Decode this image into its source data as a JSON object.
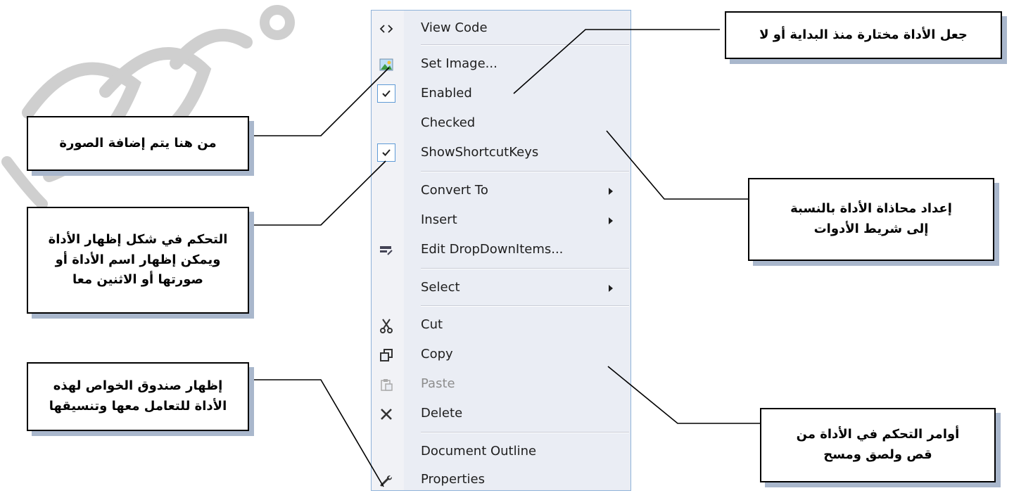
{
  "context_menu": {
    "items": [
      {
        "label": "View Code",
        "icon": "code-brackets-icon"
      },
      {
        "label": "Set Image...",
        "icon": "image-icon"
      },
      {
        "label": "Enabled",
        "icon": "checkmark-icon",
        "checked": true
      },
      {
        "label": "Checked",
        "icon": "",
        "checked": false
      },
      {
        "label": "ShowShortcutKeys",
        "icon": "checkmark-icon",
        "checked": true
      },
      {
        "label": "Convert To",
        "submenu": true
      },
      {
        "label": "Insert",
        "submenu": true
      },
      {
        "label": "Edit DropDownItems...",
        "icon": "edit-items-icon"
      },
      {
        "label": "Select",
        "submenu": true
      },
      {
        "label": "Cut",
        "icon": "scissors-icon"
      },
      {
        "label": "Copy",
        "icon": "copy-icon"
      },
      {
        "label": "Paste",
        "icon": "paste-icon",
        "disabled": true
      },
      {
        "label": "Delete",
        "icon": "delete-x-icon"
      },
      {
        "label": "Document Outline"
      },
      {
        "label": "Properties",
        "icon": "wrench-icon"
      }
    ]
  },
  "callouts": {
    "add_image": "من هنا يتم إضافة الصورة",
    "display_style": "التحكم في شكل إظهار الأداة ويمكن إظهار اسم الأداة أو صورتها  أو الاثنين معا",
    "properties_box": "إظهار صندوق الخواص لهذه الأداة للتعامل معها وتنسيقها",
    "checked_default": "جعل الأداة مختارة منذ البداية أو لا",
    "alignment": "إعداد محاذاة الأداة بالنسبة إلى شريط الأدوات",
    "edit_commands": "أوامر التحكم في الأداة من قص ولصق ومسح"
  },
  "colors": {
    "menu_background": "#eaedf4",
    "menu_border": "#8fb2d9",
    "callout_shadow": "#a9b7cc",
    "disabled_text": "#8d8d8d"
  }
}
